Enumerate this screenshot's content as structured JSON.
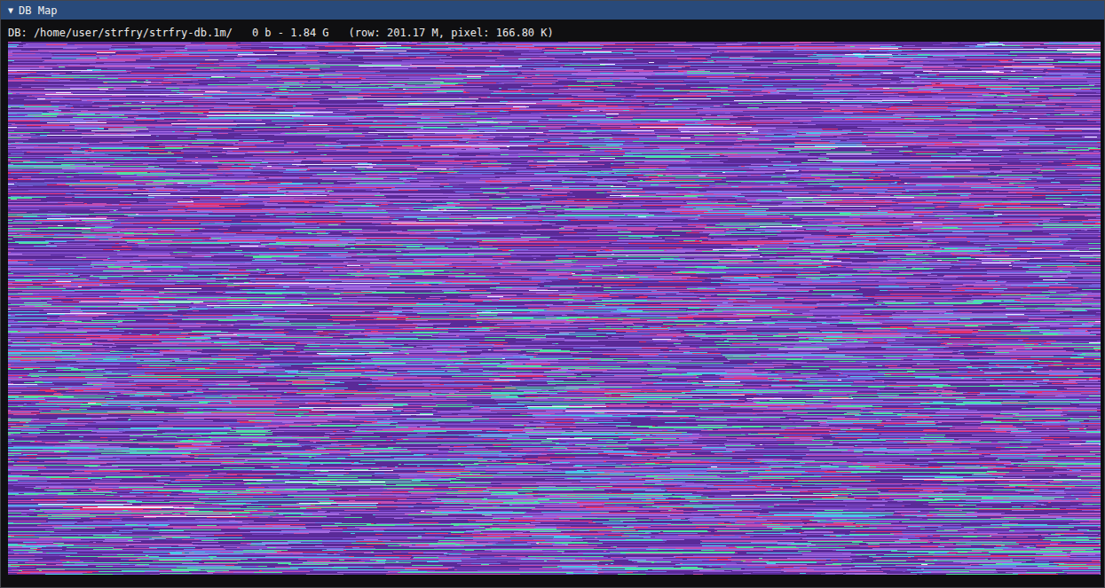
{
  "window": {
    "title": "DB Map",
    "collapse_icon": "▼"
  },
  "info": {
    "path": "DB: /home/user/strfry/strfry-db.1m/",
    "range": "0 b - 1.84 G",
    "scale": "(row: 201.17 M, pixel: 166.80 K)"
  },
  "map": {
    "palette": [
      {
        "color": "#8a55d4"
      },
      {
        "color": "#a46ae0"
      },
      {
        "color": "#7442c4"
      },
      {
        "color": "#c24eb2"
      },
      {
        "color": "#e2306c"
      },
      {
        "color": "#6c7ce8"
      },
      {
        "color": "#4cc6e8"
      },
      {
        "color": "#ecebff"
      },
      {
        "color": "#52e0a2"
      }
    ]
  }
}
